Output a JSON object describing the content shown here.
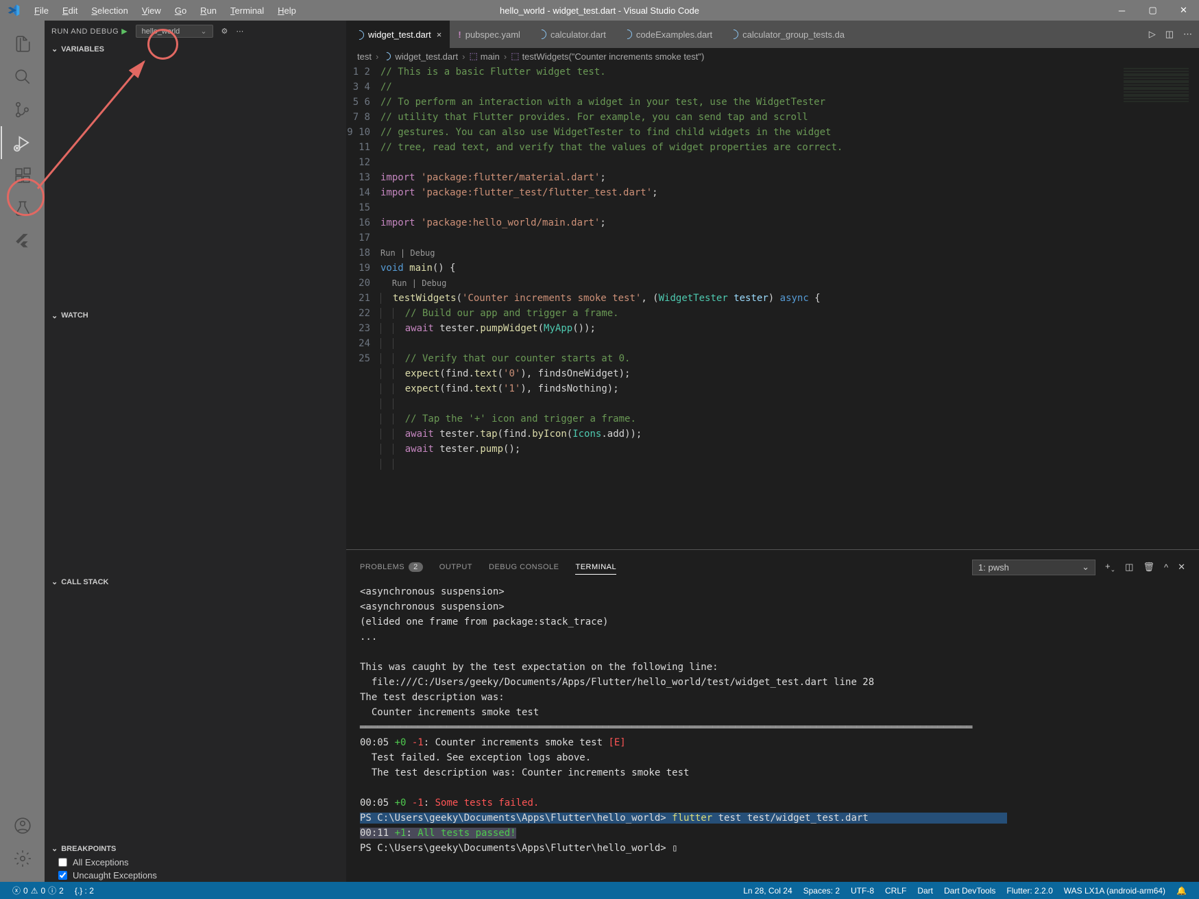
{
  "title": "hello_world - widget_test.dart - Visual Studio Code",
  "menu": [
    "File",
    "Edit",
    "Selection",
    "View",
    "Go",
    "Run",
    "Terminal",
    "Help"
  ],
  "sidebar": {
    "title": "RUN AND DEBUG",
    "config": "hello_world",
    "sections": {
      "variables": "VARIABLES",
      "watch": "WATCH",
      "callstack": "CALL STACK",
      "breakpoints": "BREAKPOINTS"
    },
    "bp": {
      "all": "All Exceptions",
      "uncaught": "Uncaught Exceptions"
    }
  },
  "tabs": [
    {
      "label": "widget_test.dart",
      "active": true,
      "icon": "dart"
    },
    {
      "label": "pubspec.yaml",
      "active": false,
      "icon": "yaml"
    },
    {
      "label": "calculator.dart",
      "active": false,
      "icon": "dart"
    },
    {
      "label": "codeExamples.dart",
      "active": false,
      "icon": "dart"
    },
    {
      "label": "calculator_group_tests.da",
      "active": false,
      "icon": "dart"
    }
  ],
  "breadcrumb": {
    "a": "test",
    "b": "widget_test.dart",
    "c": "main",
    "d": "testWidgets(\"Counter increments smoke test\")"
  },
  "codelens": {
    "run": "Run",
    "debug": "Debug"
  },
  "panel": {
    "tabs": {
      "problems": "PROBLEMS",
      "problems_count": "2",
      "output": "OUTPUT",
      "debug": "DEBUG CONSOLE",
      "terminal": "TERMINAL"
    },
    "shell": "1: pwsh"
  },
  "terminal_lines": {
    "l1": "<asynchronous suspension>",
    "l2": "<asynchronous suspension>",
    "l3": "(elided one frame from package:stack_trace)",
    "l4": "...",
    "l5": "This was caught by the test expectation on the following line:",
    "l6": "  file:///C:/Users/geeky/Documents/Apps/Flutter/hello_world/test/widget_test.dart line 28",
    "l7": "The test description was:",
    "l8": "  Counter increments smoke test",
    "l9": "══════════════════════════════════════════════════════════════════════════════════════════════════════════",
    "t1a": "00:05 ",
    "t1b": "+0 ",
    "t1c": "-1",
    "t1d": ": Counter increments smoke test ",
    "t1e": "[E]",
    "t2": "  Test failed. See exception logs above.",
    "t3": "  The test description was: Counter increments smoke test",
    "t4a": "00:05 ",
    "t4b": "+0 ",
    "t4c": "-1",
    "t4d": ": ",
    "t4e": "Some tests failed.",
    "p1a": "PS C:\\Users\\geeky\\Documents\\Apps\\Flutter\\hello_world> ",
    "p1b": "flutter",
    "p1c": " test test/widget_test.dart",
    "p2a": "00:11 ",
    "p2b": "+1",
    "p2c": ": ",
    "p2d": "All tests passed!",
    "p3": "PS C:\\Users\\geeky\\Documents\\Apps\\Flutter\\hello_world> "
  },
  "status": {
    "err": "0",
    "warn": "0",
    "info": "2",
    "brackets": "{.} : 2",
    "pos": "Ln 28, Col 24",
    "spaces": "Spaces: 2",
    "enc": "UTF-8",
    "eol": "CRLF",
    "lang": "Dart",
    "devtools": "Dart DevTools",
    "flutter": "Flutter: 2.2.0",
    "device": "WAS LX1A (android-arm64)"
  }
}
